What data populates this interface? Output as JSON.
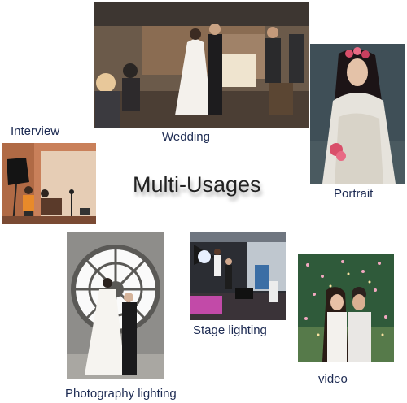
{
  "headline": "Multi-Usages",
  "captions": {
    "wedding": "Wedding",
    "interview": "Interview",
    "portrait": "Portrait",
    "stage": "Stage lighting",
    "photography": "Photography lighting",
    "video": "video"
  },
  "colors": {
    "caption": "#1c2a52",
    "headline": "#222222",
    "background": "#ffffff"
  }
}
